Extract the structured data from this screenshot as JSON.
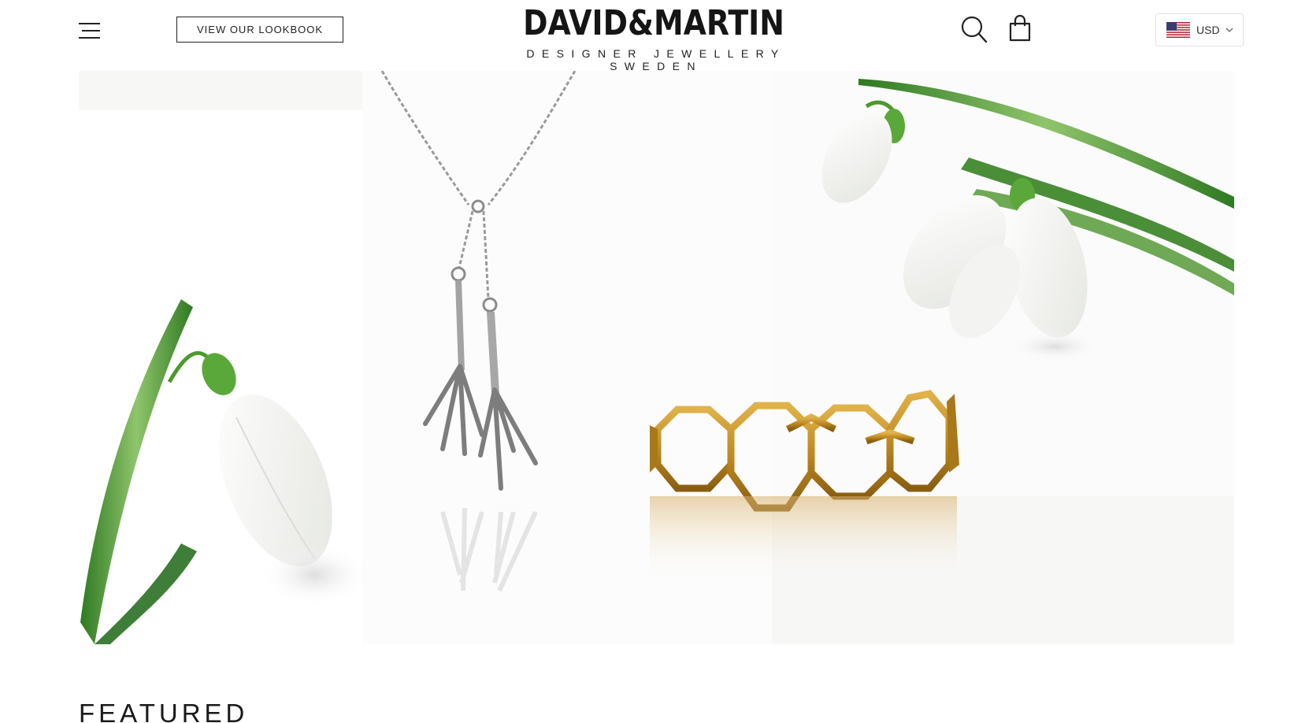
{
  "header": {
    "menu_icon": "hamburger-menu-icon",
    "lookbook_label": "VIEW OUR LOOKBOOK",
    "logo_text": "DAVID&MARTIN",
    "logo_tagline": "DESIGNER JEWELLERY SWEDEN",
    "search_icon": "search-icon",
    "cart_icon": "shopping-bag-icon",
    "currency": {
      "flag_icon": "us-flag-icon",
      "code": "USD",
      "dropdown_icon": "chevron-down-icon"
    }
  },
  "hero": {
    "image_subject": "Silver claw pendant necklace and gold hexagon cuff bracelet with white snowdrop flowers",
    "colors": {
      "background": "#fafafa",
      "gold": "#c9962a",
      "silver": "#9a9a9a",
      "leaf_green": "#3f8a2c"
    }
  },
  "featured": {
    "heading": "FEATURED"
  }
}
